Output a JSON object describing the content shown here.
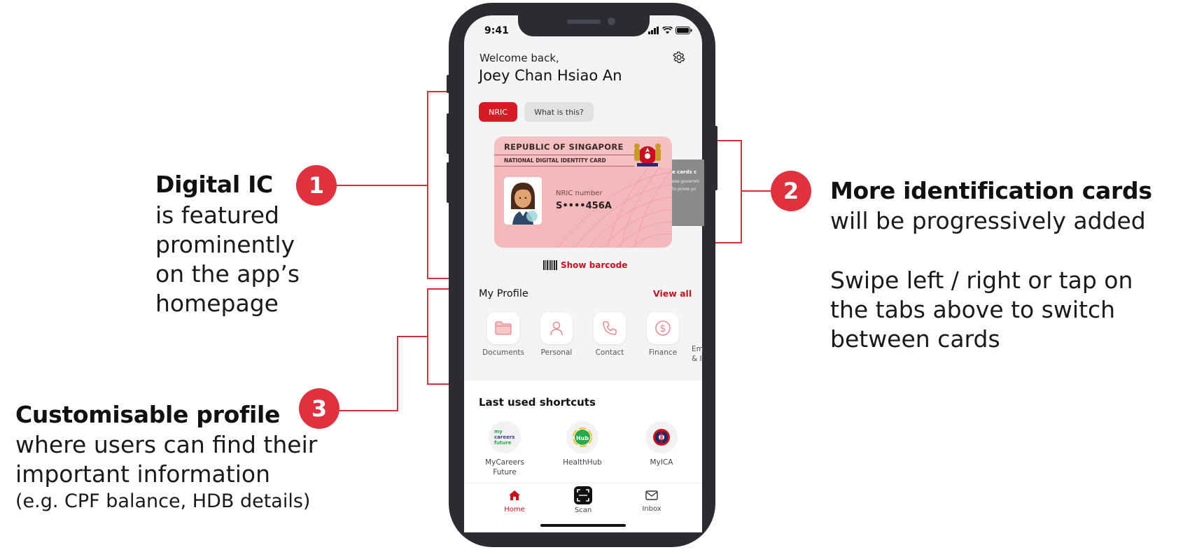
{
  "annotations": {
    "a1": {
      "badge": "1",
      "title": "Digital IC",
      "lines": [
        "is featured",
        "prominently",
        "on the app’s",
        "homepage"
      ]
    },
    "a2": {
      "badge": "2",
      "title": "More identification cards",
      "subtitle": "will be progressively added",
      "body": [
        "Swipe left / right or tap on",
        "the tabs above to switch",
        "between cards"
      ]
    },
    "a3": {
      "badge": "3",
      "title": "Customisable profile",
      "lines": [
        "where users can find their",
        "important information"
      ],
      "note": "(e.g. CPF balance, HDB details)"
    }
  },
  "phone": {
    "status_time": "9:41",
    "welcome": "Welcome back,",
    "username": "Joey Chan Hsiao An",
    "tabs": [
      {
        "label": "NRIC",
        "active": true
      },
      {
        "label": "What is this?",
        "active": false
      }
    ],
    "card": {
      "country": "REPUBLIC OF SINGAPORE",
      "type": "NATIONAL DIGITAL IDENTITY CARD",
      "nric_label": "NRIC number",
      "nric_value": "S••••456A"
    },
    "peek_card": {
      "line1": "e cards c",
      "line2": "ese governm",
      "line3": "to prove yo"
    },
    "barcode_label": "Show barcode",
    "profile": {
      "title": "My Profile",
      "view_all": "View all",
      "items": [
        {
          "label": "Documents",
          "icon": "folder-icon"
        },
        {
          "label": "Personal",
          "icon": "person-icon"
        },
        {
          "label": "Contact",
          "icon": "phone-icon"
        },
        {
          "label": "Finance",
          "icon": "dollar-icon"
        },
        {
          "label": "Em",
          "label2": "& I",
          "icon": "partial-icon"
        }
      ]
    },
    "shortcuts": {
      "title": "Last used shortcuts",
      "items": [
        {
          "label": "MyCareers",
          "label2": "Future",
          "logo": [
            "my",
            "careers",
            "future"
          ]
        },
        {
          "label": "HealthHub",
          "label2": "",
          "logo": [
            "Hub"
          ]
        },
        {
          "label": "MyICA",
          "label2": "",
          "logo": []
        }
      ]
    },
    "nav": [
      {
        "label": "Home",
        "icon": "home-icon",
        "active": true
      },
      {
        "label": "Scan",
        "icon": "scan-icon",
        "active": false
      },
      {
        "label": "Inbox",
        "icon": "mail-icon",
        "active": false
      }
    ]
  },
  "colors": {
    "accent": "#d61a26",
    "badge": "#e0313f",
    "card": "#f4b8ba"
  }
}
